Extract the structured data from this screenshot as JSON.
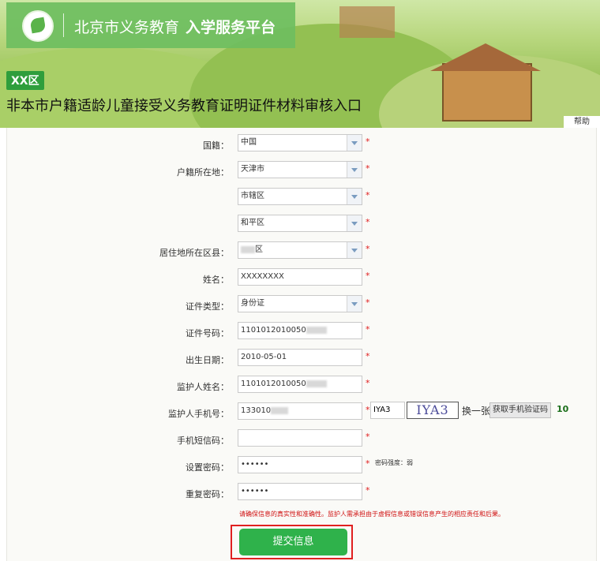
{
  "header": {
    "logo_text": "北京市义务教育",
    "logo_bold": "入学服务平台",
    "district_badge": "XX区",
    "page_title": "非本市户籍适龄儿童接受义务教育证明证件材料审核入口",
    "help_label": "帮助"
  },
  "form": {
    "nationality": {
      "label": "国籍：",
      "value": "中国"
    },
    "hukou": {
      "label": "户籍所在地：",
      "province": "天津市",
      "city": "市辖区",
      "district": "和平区"
    },
    "residence": {
      "label": "居住地所在区县：",
      "value": "区"
    },
    "name": {
      "label": "姓名：",
      "value": "XXXXXXXX"
    },
    "id_type": {
      "label": "证件类型：",
      "value": "身份证"
    },
    "id_number": {
      "label": "证件号码：",
      "value": "1101012010050"
    },
    "birth_date": {
      "label": "出生日期：",
      "value": "2010-05-01"
    },
    "guardian_name": {
      "label": "监护人姓名：",
      "value": "1101012010050"
    },
    "guardian_phone": {
      "label": "监护人手机号：",
      "value": "133010"
    },
    "captcha": {
      "value": "IYA3",
      "image_text": "IYA3",
      "refresh_label": "换一张"
    },
    "sms_button_label": "获取手机验证码",
    "countdown": "10",
    "sms_code": {
      "label": "手机短信码：",
      "value": ""
    },
    "password": {
      "label": "设置密码：",
      "value": "••••••",
      "strength_hint": "密码强度：弱"
    },
    "password_repeat": {
      "label": "重复密码：",
      "value": "••••••"
    },
    "required_mark": "*",
    "notice": "请确保信息的真实性和准确性。监护人需承担由于虚假信息或错误信息产生的相应责任和后果。",
    "submit_label": "提交信息"
  },
  "colors": {
    "accent": "#2fb24b",
    "required": "#e02020",
    "badge": "#2f9e3c"
  }
}
